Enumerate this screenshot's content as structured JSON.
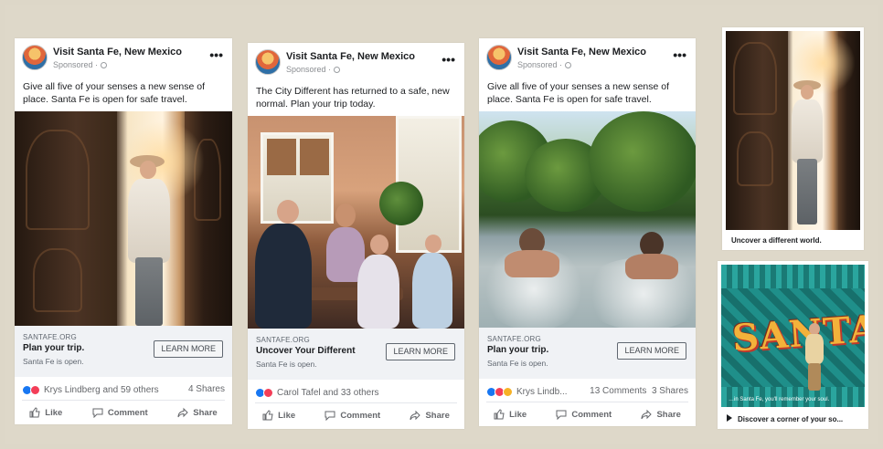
{
  "ads": [
    {
      "page_name": "Visit Santa Fe, New Mexico",
      "sponsored": "Sponsored ·",
      "text": "Give all five of your senses a new sense of place. Santa Fe is open for safe travel.",
      "domain": "SANTAFE.ORG",
      "headline": "Plan your trip.",
      "description": "Santa Fe is open.",
      "cta": "LEARN MORE",
      "reactions_text": "Krys Lindberg and 59 others",
      "comments": "",
      "shares": "4 Shares"
    },
    {
      "page_name": "Visit Santa Fe, New Mexico",
      "sponsored": "Sponsored ·",
      "text": "The City Different has returned to a safe, new normal. Plan your trip today.",
      "domain": "SANTAFE.ORG",
      "headline": "Uncover Your Different",
      "description": "Santa Fe is open.",
      "cta": "LEARN MORE",
      "reactions_text": "Carol Tafel and 33 others",
      "comments": "",
      "shares": ""
    },
    {
      "page_name": "Visit Santa Fe, New Mexico",
      "sponsored": "Sponsored ·",
      "text": "Give all five of your senses a new sense of place. Santa Fe is open for safe travel.",
      "domain": "SANTAFE.ORG",
      "headline": "Plan your trip.",
      "description": "Santa Fe is open.",
      "cta": "LEARN MORE",
      "reactions_text": "Krys Lindb...",
      "comments": "13 Comments",
      "shares": "3 Shares"
    }
  ],
  "actions": {
    "like": "Like",
    "comment": "Comment",
    "share": "Share"
  },
  "stories": [
    {
      "caption": "Uncover a different world."
    },
    {
      "caption": "Discover a corner of your so...",
      "overlay": "…in Santa Fe, you'll remember your soul.",
      "mural_text": "SANTA"
    }
  ],
  "colors": {
    "background": "#ddd7c8",
    "facebook_blue": "#1877f2",
    "love_red": "#f33e58",
    "wow_yellow": "#f7b125"
  },
  "icons": [
    "more-icon",
    "globe-icon",
    "like-icon",
    "comment-icon",
    "share-icon",
    "play-icon"
  ]
}
